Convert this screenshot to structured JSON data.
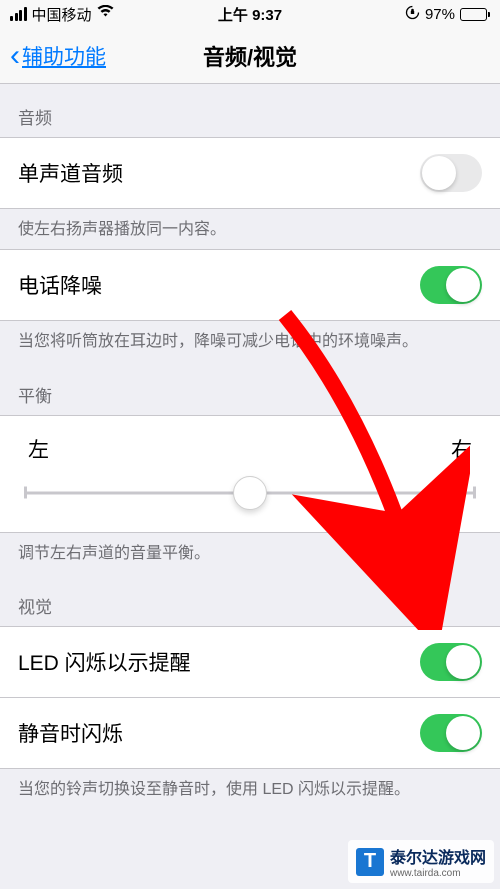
{
  "status": {
    "carrier": "中国移动",
    "time": "上午 9:37",
    "battery_pct": "97%"
  },
  "nav": {
    "back_label": "辅助功能",
    "title": "音频/视觉"
  },
  "sections": {
    "audio_header": "音频",
    "balance_header": "平衡",
    "visual_header": "视觉"
  },
  "rows": {
    "mono_audio": {
      "label": "单声道音频",
      "on": false
    },
    "mono_footer": "使左右扬声器播放同一内容。",
    "noise_cancel": {
      "label": "电话降噪",
      "on": true
    },
    "noise_footer": "当您将听筒放在耳边时，降噪可减少电话中的环境噪声。",
    "balance": {
      "left": "左",
      "right": "右"
    },
    "balance_footer": "调节左右声道的音量平衡。",
    "led_flash": {
      "label": "LED 闪烁以示提醒",
      "on": true
    },
    "silent_flash": {
      "label": "静音时闪烁",
      "on": true
    },
    "led_footer": "当您的铃声切换设至静音时，使用 LED 闪烁以示提醒。"
  },
  "watermark": {
    "name": "泰尔达游戏网",
    "url": "www.tairda.com",
    "icon_letter": "T"
  }
}
